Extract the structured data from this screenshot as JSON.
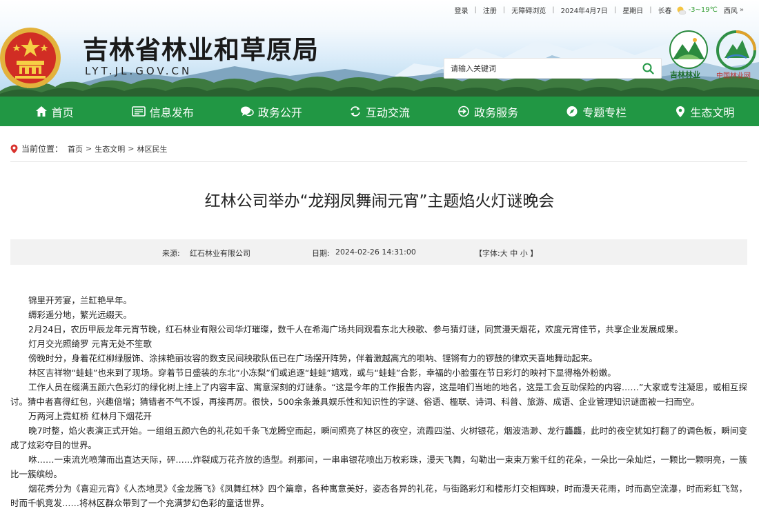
{
  "topbar": {
    "login": "登录",
    "register": "注册",
    "accessible": "无障碍浏览",
    "date": "2024年4月7日",
    "weekday": "星期日",
    "city": "长春",
    "weather_icon": "sun-cloud-icon",
    "temperature": "-3~19℃",
    "wind": "西风",
    "more_icon": "»"
  },
  "header": {
    "title": "吉林省林业和草原局",
    "domain": "LYT.JL.GOV.CN",
    "search_placeholder": "请输入关键词",
    "logo_jilin_text": "吉林林业",
    "logo_china_text": "中国林业网"
  },
  "nav": [
    {
      "label": "首页",
      "icon": "home-icon"
    },
    {
      "label": "信息发布",
      "icon": "document-icon"
    },
    {
      "label": "政务公开",
      "icon": "chat-icon"
    },
    {
      "label": "互动交流",
      "icon": "refresh-icon"
    },
    {
      "label": "政务服务",
      "icon": "login-icon"
    },
    {
      "label": "专题专栏",
      "icon": "compass-icon"
    },
    {
      "label": "生态文明",
      "icon": "pin-icon"
    }
  ],
  "breadcrumb": {
    "label": "当前位置：",
    "items": [
      "首页",
      "生态文明",
      "林区民生"
    ]
  },
  "article": {
    "title": "红林公司举办“龙翔凤舞闹元宵”主题焰火灯谜晚会",
    "source_label": "来源:",
    "source": "红石林业有限公司",
    "date_label": "日期:",
    "date": "2024-02-26 14:31:00",
    "fontsize_prefix": "【字体:",
    "fontsize_big": "大",
    "fontsize_mid": "中",
    "fontsize_small": "小",
    "fontsize_suffix": "】",
    "paragraphs": [
      "锦里开芳宴，兰缸艳早年。",
      "缛彩遥分地，繁光远缀天。",
      "2月24日，农历甲辰龙年元宵节晚，红石林业有限公司华灯璀璨，数千人在希海广场共同观看东北大秧歌、参与猜灯谜，同赏漫天烟花，欢度元宵佳节，共享企业发展成果。",
      "灯月交光照绮罗 元宵无处不笙歌",
      "傍晚时分，身着花红柳绿服饰、涂抹艳丽妆容的数支民间秧歌队伍已在广场摆开阵势，伴着激越高亢的唢呐、铿锵有力的锣鼓的律欢天喜地舞动起来。",
      "林区吉祥物“蛙蛙”也来到了现场。穿着节日盛装的东北“小冻梨”们或追逐“蛙蛙”嬉戏，或与“蛙蛙”合影，幸福的小脸蛋在节日彩灯的映衬下显得格外粉嫩。",
      "工作人员在缀满五颜六色彩灯的绿化树上挂上了内容丰富、寓意深刻的灯谜条。“这是今年的工作报告内容，这是咱们当地的地名，这是工会互助保险的内容……”大家或专注凝思，或相互探讨。猜中者喜得红包，兴趣倍增；猜错者不气不馁，再接再厉。很快，500余条兼具娱乐性和知识性的字谜、俗语、楹联、诗词、科普、旅游、成语、企业管理知识谜面被一扫而空。",
      "万两河上霓虹桥 红林月下烟花开",
      "晚7时整，焰火表演正式开始。一组组五颜六色的礼花如千条飞龙腾空而起，瞬间照亮了林区的夜空，流霞四溢、火树银花，烟波浩渺、龙行龘龘，此时的夜空犹如打翻了的调色板，瞬间变成了炫彩夺目的世界。",
      "咻……一束流光喷薄而出直达天际，砰……炸裂成万花齐放的造型。刹那间，一串串银花喷出万枚彩珠，漫天飞舞，勾勒出一束束万紫千红的花朵，一朵比一朵灿烂，一颗比一颗明亮，一簇比一簇缤纷。",
      "烟花秀分为《喜迎元宵》《人杰地灵》《金龙腾飞》《凤舞红林》四个篇章，各种寓意美好，姿态各异的礼花，与街路彩灯和楼形灯交相辉映，时而漫天花雨，时而高空流瀑，时而彩虹飞驾，时而千帆竞发……将林区群众带到了一个充满梦幻色彩的童话世界。"
    ]
  },
  "colors": {
    "nav_green": "#219744",
    "meta_bg": "#f2f2f2",
    "crumb_icon_red": "#d9332e"
  }
}
